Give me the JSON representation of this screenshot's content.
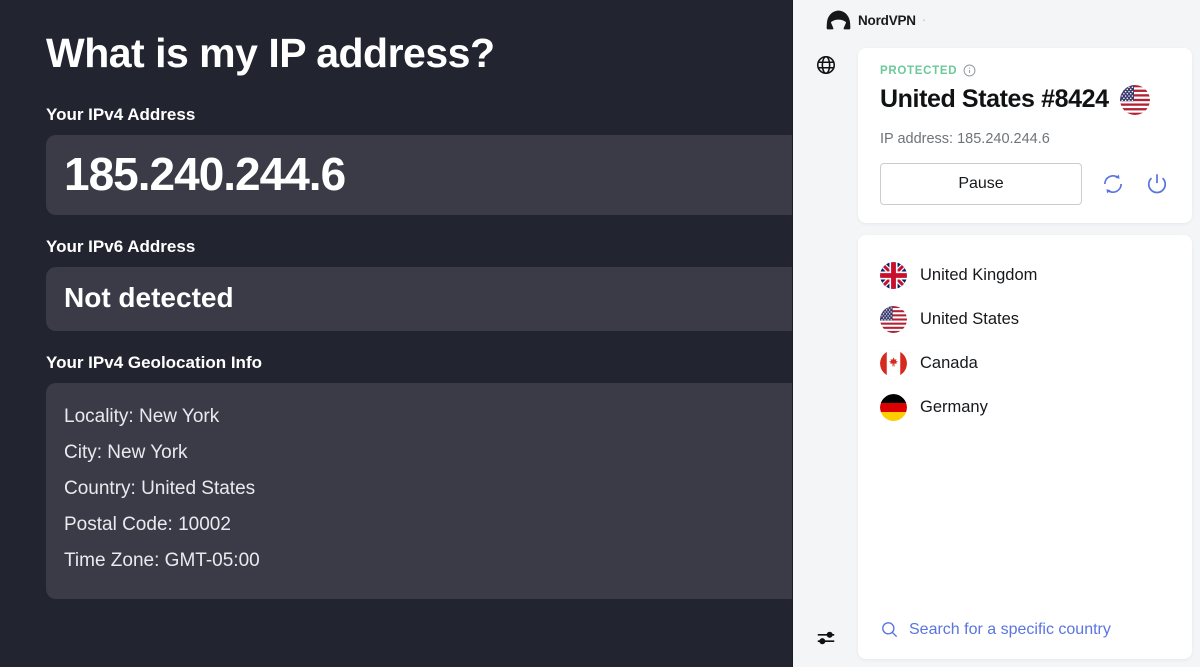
{
  "ip_page": {
    "title": "What is my IP address?",
    "ipv4_label": "Your IPv4 Address",
    "ipv4_value": "185.240.244.6",
    "ipv6_label": "Your IPv6 Address",
    "ipv6_value": "Not detected",
    "geo_label": "Your IPv4 Geolocation Info",
    "geo_lines": [
      "Locality: New York",
      "City: New York",
      "Country: United States",
      "Postal Code: 10002",
      "Time Zone: GMT-05:00"
    ]
  },
  "vpn_panel": {
    "brand": "NordVPN",
    "brand_tm": "·",
    "rail": {
      "globe_icon": "globe-icon",
      "settings_icon": "sliders-icon"
    },
    "status": {
      "badge": "PROTECTED",
      "info_icon": "info-icon",
      "server": "United States #8424",
      "server_flag": "us-flag",
      "ip_line": "IP address: 185.240.244.6",
      "pause_label": "Pause",
      "refresh_icon": "refresh-icon",
      "power_icon": "power-icon"
    },
    "countries": [
      {
        "name": "United Kingdom",
        "flag": "uk-flag"
      },
      {
        "name": "United States",
        "flag": "us-flag"
      },
      {
        "name": "Canada",
        "flag": "ca-flag"
      },
      {
        "name": "Germany",
        "flag": "de-flag"
      }
    ],
    "search": {
      "icon": "search-icon",
      "placeholder": "Search for a specific country"
    }
  },
  "colors": {
    "page_bg": "#22242f",
    "value_box_bg": "#3a3b47",
    "panel_bg": "#f4f5f6",
    "protected_green": "#6cc99a",
    "accent_blue": "#5a74e0"
  }
}
